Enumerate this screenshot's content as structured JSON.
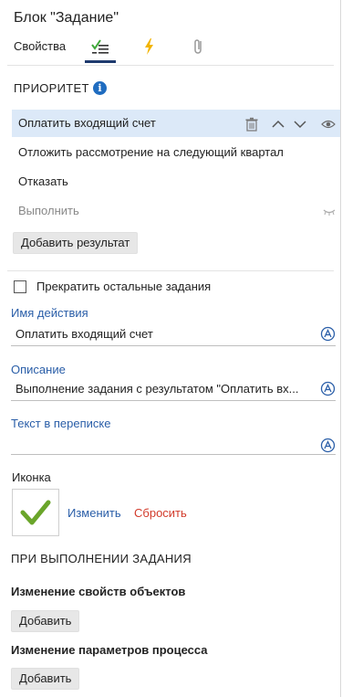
{
  "header": {
    "title": "Блок \"Задание\""
  },
  "tabs": {
    "properties_label": "Свойства"
  },
  "priority": {
    "title": "ПРИОРИТЕТ",
    "info_glyph": "i"
  },
  "results": [
    {
      "label": "Оплатить входящий счет",
      "selected": true
    },
    {
      "label": "Отложить рассмотрение на следующий квартал",
      "selected": false
    },
    {
      "label": "Отказать",
      "selected": false
    },
    {
      "label": "Выполнить",
      "selected": false,
      "hidden": true
    }
  ],
  "add_result_label": "Добавить результат",
  "stop_others_label": "Прекратить остальные задания",
  "fields": {
    "action_name": {
      "label": "Имя действия",
      "value": "Оплатить входящий счет"
    },
    "description": {
      "label": "Описание",
      "value": "Выполнение задания с результатом \"Оплатить вх..."
    },
    "correspondence": {
      "label": "Текст в переписке",
      "value": ""
    }
  },
  "icon_section": {
    "label": "Иконка",
    "change_label": "Изменить",
    "reset_label": "Сбросить"
  },
  "on_complete": {
    "title": "ПРИ ВЫПОЛНЕНИИ ЗАДАНИЯ",
    "object_props_title": "Изменение свойств объектов",
    "process_params_title": "Изменение параметров процесса",
    "add_label": "Добавить"
  },
  "colors": {
    "accent": "#1f6cc0",
    "link": "#2a5ea8",
    "reset": "#d23b2b",
    "selected_row": "#dce9f8",
    "check": "#6aa52a"
  }
}
